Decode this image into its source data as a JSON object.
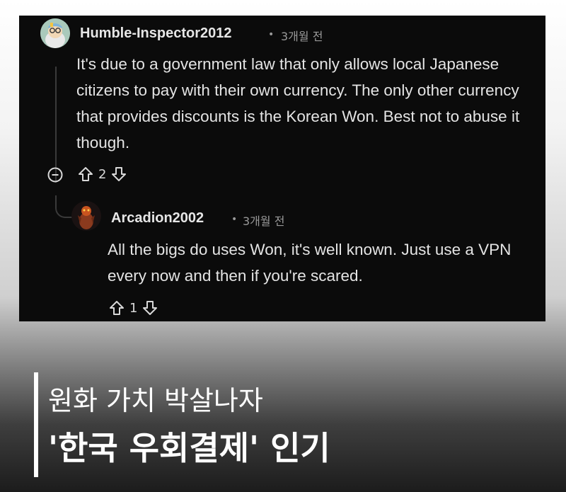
{
  "comments": [
    {
      "username": "Humble-Inspector2012",
      "separator": "•",
      "time": "3개월 전",
      "body": "It's due to a government law that only allows local Japanese citizens to pay with their own currency. The only other currency that provides discounts is the Korean Won. Best not to abuse it though.",
      "votes": "2"
    },
    {
      "username": "Arcadion2002",
      "separator": "•",
      "time": "3개월 전",
      "body": "All the bigs do uses Won, it's well known. Just use a VPN every now and then if you're scared.",
      "votes": "1"
    }
  ],
  "caption": {
    "line1": "원화 가치 박살나자",
    "line2": "'한국 우회결제' 인기"
  },
  "colors": {
    "panel_bg": "#0b0b0b",
    "text": "#e4e4e4",
    "muted": "#9a9a9a"
  }
}
